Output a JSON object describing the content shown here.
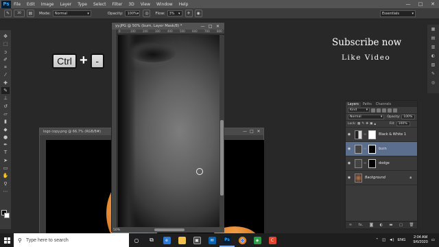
{
  "app": {
    "logo": "Ps",
    "accent": "#31a8ff"
  },
  "menu": [
    "File",
    "Edit",
    "Image",
    "Layer",
    "Type",
    "Select",
    "Filter",
    "3D",
    "View",
    "Window",
    "Help"
  ],
  "window_controls": {
    "minimize": "—",
    "maximize": "□",
    "close": "✕"
  },
  "options": {
    "brush_size": "30",
    "mode_label": "Mode:",
    "mode_value": "Normal",
    "opacity_label": "Opacity:",
    "opacity_value": "100%",
    "flow_label": "Flow:",
    "flow_value": "3%",
    "workspace": "Essentials"
  },
  "overlay": {
    "key_ctrl": "Ctrl",
    "plus": "+",
    "key_minus": "-",
    "subscribe": "Subscribe now",
    "like_video": "Like Video"
  },
  "doc_main": {
    "title": "yy.JPG @ 50% (burn, Layer Mask/8) *",
    "zoom": "50%",
    "ruler": [
      "0",
      "100",
      "200",
      "300",
      "400",
      "500",
      "600",
      "700",
      "800"
    ]
  },
  "doc_back": {
    "title": "logo copy.png @ 66.7% (RGB/8#)"
  },
  "layers": {
    "tabs": [
      "Layers",
      "Paths",
      "Channels"
    ],
    "kind_label": "Kind",
    "blend_mode": "Normal",
    "opacity_label": "Opacity:",
    "opacity_value": "100%",
    "lock_label": "Lock:",
    "fill_label": "Fill:",
    "fill_value": "100%",
    "items": [
      {
        "name": "Black & White 1",
        "selected": false
      },
      {
        "name": "burn",
        "selected": true
      },
      {
        "name": "dodge",
        "selected": false
      },
      {
        "name": "Background",
        "selected": false
      }
    ],
    "footer_icons": [
      "link-icon",
      "fx-icon",
      "mask-icon",
      "adjustment-icon",
      "folder-icon",
      "new-layer-icon",
      "trash-icon"
    ],
    "fx": "fx."
  },
  "taskbar": {
    "search_placeholder": "Type here to search",
    "language": "ENG",
    "time": "2:04 AM",
    "date": "9/6/2020"
  }
}
